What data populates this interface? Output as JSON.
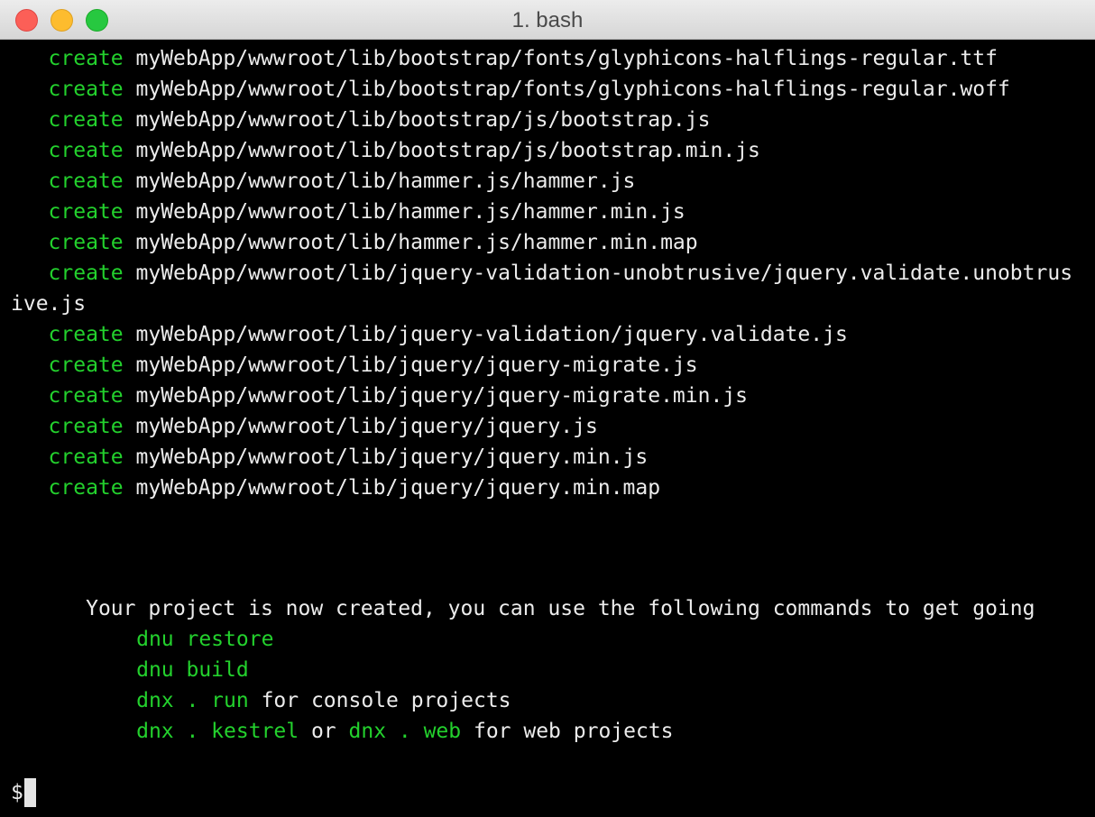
{
  "window": {
    "title": "1. bash"
  },
  "terminal": {
    "created_lines": [
      {
        "verb": "create",
        "path": "myWebApp/wwwroot/lib/bootstrap/fonts/glyphicons-halflings-regular.ttf"
      },
      {
        "verb": "create",
        "path": "myWebApp/wwwroot/lib/bootstrap/fonts/glyphicons-halflings-regular.woff"
      },
      {
        "verb": "create",
        "path": "myWebApp/wwwroot/lib/bootstrap/js/bootstrap.js"
      },
      {
        "verb": "create",
        "path": "myWebApp/wwwroot/lib/bootstrap/js/bootstrap.min.js"
      },
      {
        "verb": "create",
        "path": "myWebApp/wwwroot/lib/hammer.js/hammer.js"
      },
      {
        "verb": "create",
        "path": "myWebApp/wwwroot/lib/hammer.js/hammer.min.js"
      },
      {
        "verb": "create",
        "path": "myWebApp/wwwroot/lib/hammer.js/hammer.min.map"
      },
      {
        "verb": "create",
        "path": "myWebApp/wwwroot/lib/jquery-validation-unobtrusive/jquery.validate.unobtrus"
      }
    ],
    "wrapped_continuation": "ive.js",
    "created_lines_after": [
      {
        "verb": "create",
        "path": "myWebApp/wwwroot/lib/jquery-validation/jquery.validate.js"
      },
      {
        "verb": "create",
        "path": "myWebApp/wwwroot/lib/jquery/jquery-migrate.js"
      },
      {
        "verb": "create",
        "path": "myWebApp/wwwroot/lib/jquery/jquery-migrate.min.js"
      },
      {
        "verb": "create",
        "path": "myWebApp/wwwroot/lib/jquery/jquery.js"
      },
      {
        "verb": "create",
        "path": "myWebApp/wwwroot/lib/jquery/jquery.min.js"
      },
      {
        "verb": "create",
        "path": "myWebApp/wwwroot/lib/jquery/jquery.min.map"
      }
    ],
    "message": "Your project is now created, you can use the following commands to get going",
    "commands": {
      "restore": "dnu restore",
      "build": "dnu build",
      "run_cmd": "dnx . run",
      "run_suffix": " for console projects",
      "kestrel_cmd": "dnx . kestrel",
      "or_text": " or ",
      "web_cmd": "dnx . web",
      "web_suffix": " for web projects"
    },
    "prompt": "$"
  }
}
